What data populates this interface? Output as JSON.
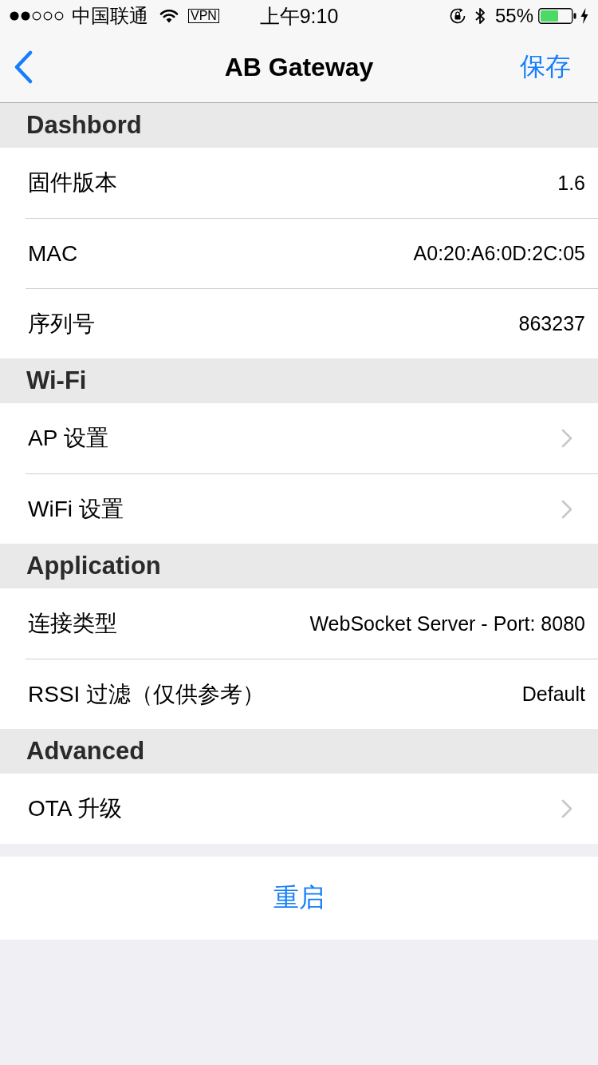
{
  "status_bar": {
    "carrier": "中国联通",
    "vpn": "VPN",
    "time": "上午9:10",
    "battery": "55%"
  },
  "nav_bar": {
    "title": "AB Gateway",
    "action": "保存"
  },
  "sections": [
    {
      "title": "Dashbord",
      "rows": [
        {
          "kind": "value",
          "label": "固件版本",
          "value": "1.6"
        },
        {
          "kind": "value",
          "label": "MAC",
          "value": "A0:20:A6:0D:2C:05"
        },
        {
          "kind": "value",
          "label": "序列号",
          "value": "863237"
        }
      ]
    },
    {
      "title": "Wi-Fi",
      "rows": [
        {
          "kind": "link",
          "label": "AP 设置"
        },
        {
          "kind": "link",
          "label": "WiFi 设置"
        }
      ]
    },
    {
      "title": "Application",
      "rows": [
        {
          "kind": "value",
          "label": "连接类型",
          "value": "WebSocket Server - Port: 8080"
        },
        {
          "kind": "value",
          "label": "RSSI 过滤（仅供参考）",
          "value": "Default"
        }
      ]
    },
    {
      "title": "Advanced",
      "rows": [
        {
          "kind": "link",
          "label": "OTA 升级"
        }
      ]
    }
  ],
  "restart_button": {
    "label": "重启"
  }
}
